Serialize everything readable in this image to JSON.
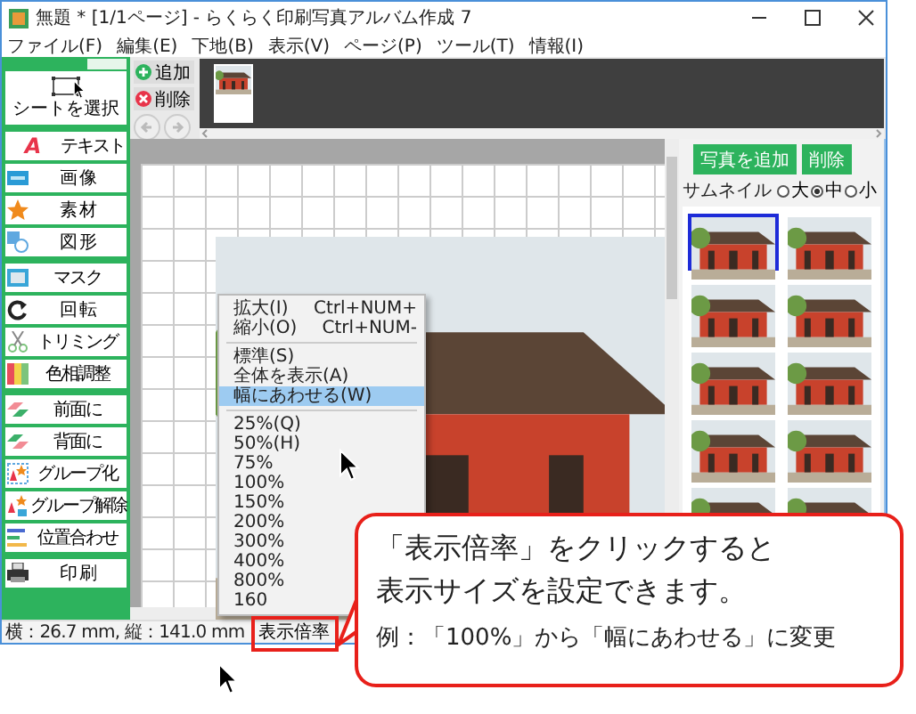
{
  "window": {
    "title": "無題 * [1/1ページ] - らくらく印刷写真アルバム作成 7"
  },
  "menu": [
    "ファイル(F)",
    "編集(E)",
    "下地(B)",
    "表示(V)",
    "ページ(P)",
    "ツール(T)",
    "情報(I)"
  ],
  "tools": {
    "select_sheet": "シートを選択",
    "groups": [
      [
        {
          "label": "テキスト",
          "glyph": "A"
        },
        {
          "label": "画 像"
        },
        {
          "label": "素 材"
        },
        {
          "label": "図 形"
        }
      ],
      [
        {
          "label": "マスク"
        },
        {
          "label": "回 転"
        },
        {
          "label": "トリミング"
        },
        {
          "label": "色相調整"
        }
      ],
      [
        {
          "label": "前面に"
        },
        {
          "label": "背面に"
        },
        {
          "label": "グループ化"
        },
        {
          "label": "グループ解除"
        },
        {
          "label": "位置合わせ"
        }
      ],
      [
        {
          "label": "印 刷"
        }
      ]
    ]
  },
  "page_toolbar": {
    "add": "追加",
    "delete": "削除"
  },
  "photo_panel": {
    "add": "写真を追加",
    "delete": "削除",
    "thumbnail_label": "サムネイル",
    "sizes": [
      {
        "label": "大",
        "selected": false
      },
      {
        "label": "中",
        "selected": true
      },
      {
        "label": "小",
        "selected": false
      }
    ],
    "thumbnails": [
      {
        "selected": true
      },
      {
        "selected": false
      },
      {
        "selected": false
      },
      {
        "selected": false
      },
      {
        "selected": false
      },
      {
        "selected": false
      },
      {
        "selected": false
      },
      {
        "selected": false
      },
      {
        "selected": false
      },
      {
        "selected": false
      }
    ]
  },
  "context_menu": {
    "items": [
      {
        "kind": "item",
        "label": "拡大(I)",
        "shortcut": "Ctrl+NUM+",
        "selected": false
      },
      {
        "kind": "item",
        "label": "縮小(O)",
        "shortcut": "Ctrl+NUM-",
        "selected": false
      },
      {
        "kind": "separator"
      },
      {
        "kind": "item",
        "label": "標準(S)",
        "selected": false
      },
      {
        "kind": "item",
        "label": "全体を表示(A)",
        "selected": false
      },
      {
        "kind": "item",
        "label": "幅にあわせる(W)",
        "selected": true
      },
      {
        "kind": "separator"
      },
      {
        "kind": "item",
        "label": "25%(Q)",
        "selected": false
      },
      {
        "kind": "item",
        "label": "50%(H)",
        "selected": false
      },
      {
        "kind": "item",
        "label": "75%",
        "selected": false
      },
      {
        "kind": "item",
        "label": "100%",
        "selected": false
      },
      {
        "kind": "item",
        "label": "150%",
        "selected": false
      },
      {
        "kind": "item",
        "label": "200%",
        "selected": false
      },
      {
        "kind": "item",
        "label": "300%",
        "selected": false
      },
      {
        "kind": "item",
        "label": "400%",
        "selected": false
      },
      {
        "kind": "item",
        "label": "800%",
        "selected": false
      },
      {
        "kind": "item",
        "label": "160",
        "selected": false
      }
    ]
  },
  "status_bar": {
    "size": "横：26.7 mm, 縦：141.0 mm",
    "zoom": "表示倍率"
  },
  "callout": {
    "lines": [
      "「表示倍率」をクリックすると",
      "表示サイズを設定できます。",
      "例：「100%」から「幅にあわせる」に変更"
    ]
  }
}
